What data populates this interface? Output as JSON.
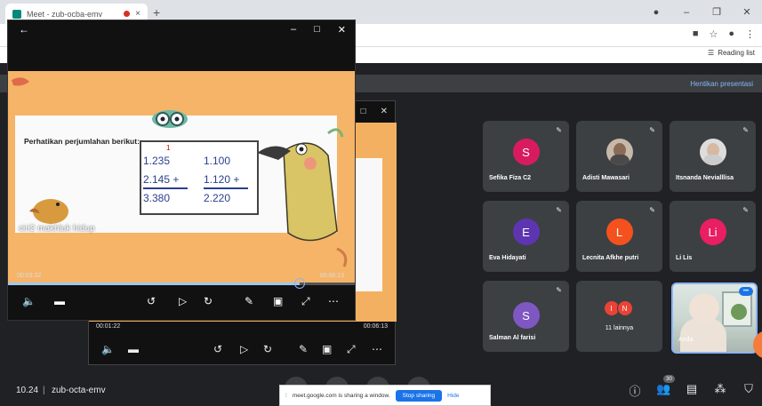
{
  "browser": {
    "tab_title": "Meet - zub-ocba-emv",
    "tab_close": "×",
    "new_tab": "+",
    "reading_list": "Reading list"
  },
  "meet": {
    "stop_presenting": "Hentikan presentasi",
    "participants": [
      {
        "name": "Sefika Fiza C2",
        "initial": "S",
        "color": "#d81b60"
      },
      {
        "name": "Adisti Mawasari",
        "initial": "",
        "color": ""
      },
      {
        "name": "Itsnanda Nevialllisa",
        "initial": "",
        "color": ""
      },
      {
        "name": "Eva Hidayati",
        "initial": "E",
        "color": "#5e35b1"
      },
      {
        "name": "Lecnita Afkhe putri",
        "initial": "L",
        "color": "#f4511e"
      },
      {
        "name": "Li Lis",
        "initial": "Li",
        "color": "#e91e63"
      },
      {
        "name": "Salman Al farisi",
        "initial": "S",
        "color": "#7e57c2"
      }
    ],
    "others_tile": {
      "initials": [
        "I",
        "N"
      ],
      "label": "11 lainnya"
    },
    "self_tile": {
      "name": "Anda"
    },
    "clock": "10.24",
    "separator": "|",
    "meeting_code": "zub-octa-emv",
    "participant_count": "30",
    "share_notice": {
      "text": "meet.google.com is sharing a window.",
      "stop": "Stop sharing",
      "hide": "Hide"
    }
  },
  "player_main": {
    "caption": "ciri2 makhluk hidup",
    "slide_heading": "Perhatikan perjumlahan berikut:",
    "carry": "1",
    "col1": [
      "1.235",
      "2.145 +",
      "3.380"
    ],
    "col2": [
      "1.100",
      "1.120 +",
      "2.220"
    ],
    "time_elapsed": "00:03:32",
    "time_total": "00:06:13",
    "progress": 0.84
  },
  "player_back": {
    "time_elapsed": "00:01:22",
    "time_total": "00:06:13"
  }
}
